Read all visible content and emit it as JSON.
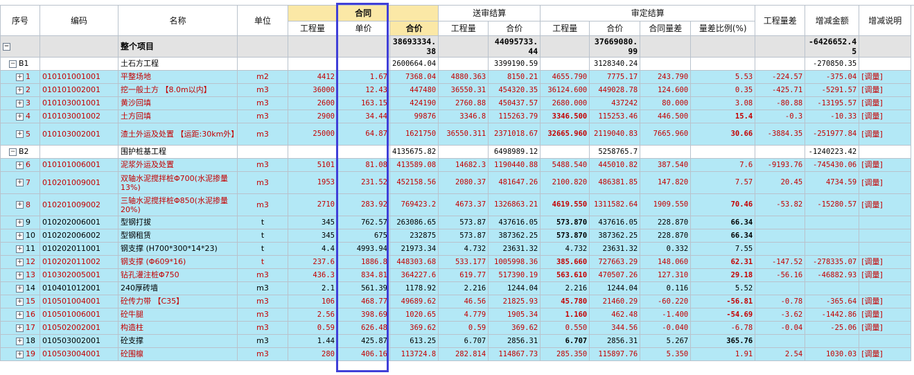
{
  "header": {
    "seq": "序号",
    "code": "编码",
    "name": "名称",
    "unit": "单位",
    "contract": "合同",
    "contract_qty": "工程量",
    "contract_price": "单价",
    "contract_total": "合价",
    "submitted": "送审结算",
    "sub_qty": "工程量",
    "sub_total": "合价",
    "approved": "审定结算",
    "app_qty": "工程量",
    "app_total": "合价",
    "app_diff": "合同量差",
    "app_ratio": "量差比例(%)",
    "qty_diff": "工程量差",
    "amount_change": "增减金额",
    "change_desc": "增减说明"
  },
  "rows": [
    {
      "type": "total",
      "seq": "",
      "code": "",
      "name": "整个项目",
      "unit": "",
      "cqty": "",
      "cprice": "",
      "ctotal": "38693334.38",
      "sqty": "",
      "stotal": "44095733.44",
      "aqty": "",
      "atotal": "37669080.99",
      "adiff": "",
      "aratio": "",
      "qdiff": "",
      "amount": "-6426652.45",
      "desc": ""
    },
    {
      "type": "grp",
      "seq": "B1",
      "code": "",
      "name": "土石方工程",
      "unit": "",
      "cqty": "",
      "cprice": "",
      "ctotal": "2600664.04",
      "sqty": "",
      "stotal": "3399190.59",
      "aqty": "",
      "atotal": "3128340.24",
      "adiff": "",
      "aratio": "",
      "qdiff": "",
      "amount": "-270850.35",
      "desc": ""
    },
    {
      "type": "item",
      "red": true,
      "seq": "1",
      "code": "010101001001",
      "name": "平整场地",
      "unit": "m2",
      "cqty": "4412",
      "cprice": "1.67",
      "ctotal": "7368.04",
      "sqty": "4880.363",
      "stotal": "8150.21",
      "aqty": "4655.790",
      "atotal": "7775.17",
      "adiff": "243.790",
      "aratio": "5.53",
      "qdiff": "-224.57",
      "amount": "-375.04",
      "desc": "[调量]"
    },
    {
      "type": "item",
      "red": true,
      "seq": "2",
      "code": "010101002001",
      "name": "挖一般土方 【8.0m以内】",
      "unit": "m3",
      "cqty": "36000",
      "cprice": "12.43",
      "ctotal": "447480",
      "sqty": "36550.31",
      "stotal": "454320.35",
      "aqty": "36124.600",
      "atotal": "449028.78",
      "adiff": "124.600",
      "aratio": "0.35",
      "qdiff": "-425.71",
      "amount": "-5291.57",
      "desc": "[调量]"
    },
    {
      "type": "item",
      "red": true,
      "seq": "3",
      "code": "010103001001",
      "name": "黄沙回填",
      "unit": "m3",
      "cqty": "2600",
      "cprice": "163.15",
      "ctotal": "424190",
      "sqty": "2760.88",
      "stotal": "450437.57",
      "aqty": "2680.000",
      "atotal": "437242",
      "adiff": "80.000",
      "aratio": "3.08",
      "qdiff": "-80.88",
      "amount": "-13195.57",
      "desc": "[调量]"
    },
    {
      "type": "item",
      "red": true,
      "seq": "4",
      "code": "010103001002",
      "name": "土方回填",
      "unit": "m3",
      "cqty": "2900",
      "cprice": "34.44",
      "ctotal": "99876",
      "sqty": "3346.8",
      "stotal": "115263.79",
      "aqty": "3346.500",
      "aqtyb": true,
      "atotal": "115253.46",
      "adiff": "446.500",
      "aratio": "15.4",
      "aratiob": true,
      "qdiff": "-0.3",
      "amount": "-10.33",
      "desc": "[调量]"
    },
    {
      "type": "item",
      "red": true,
      "tall": true,
      "seq": "5",
      "code": "010103002001",
      "name": "渣土外运及处置 【运距:30km外】",
      "unit": "m3",
      "cqty": "25000",
      "cprice": "64.87",
      "ctotal": "1621750",
      "sqty": "36550.311",
      "stotal": "2371018.67",
      "aqty": "32665.960",
      "aqtyb": true,
      "atotal": "2119040.83",
      "adiff": "7665.960",
      "aratio": "30.66",
      "aratiob": true,
      "qdiff": "-3884.35",
      "amount": "-251977.84",
      "desc": "[调量]"
    },
    {
      "type": "grp",
      "seq": "B2",
      "code": "",
      "name": "围护桩基工程",
      "unit": "",
      "cqty": "",
      "cprice": "",
      "ctotal": "4135675.82",
      "sqty": "",
      "stotal": "6498989.12",
      "aqty": "",
      "atotal": "5258765.7",
      "adiff": "",
      "aratio": "",
      "qdiff": "",
      "amount": "-1240223.42",
      "desc": ""
    },
    {
      "type": "item",
      "red": true,
      "seq": "6",
      "code": "010101006001",
      "name": "泥浆外运及处置",
      "unit": "m3",
      "cqty": "5101",
      "cprice": "81.08",
      "ctotal": "413589.08",
      "sqty": "14682.3",
      "stotal": "1190440.88",
      "aqty": "5488.540",
      "atotal": "445010.82",
      "adiff": "387.540",
      "aratio": "7.6",
      "qdiff": "-9193.76",
      "amount": "-745430.06",
      "desc": "[调量]"
    },
    {
      "type": "item",
      "red": true,
      "tall": true,
      "seq": "7",
      "code": "010201009001",
      "name": "双轴水泥搅拌桩Φ700(水泥掺量13%)",
      "unit": "m3",
      "cqty": "1953",
      "cprice": "231.52",
      "ctotal": "452158.56",
      "sqty": "2080.37",
      "stotal": "481647.26",
      "aqty": "2100.820",
      "atotal": "486381.85",
      "adiff": "147.820",
      "aratio": "7.57",
      "qdiff": "20.45",
      "amount": "4734.59",
      "desc": "[调量]"
    },
    {
      "type": "item",
      "red": true,
      "tall": true,
      "seq": "8",
      "code": "010201009002",
      "name": "三轴水泥搅拌桩Φ850(水泥掺量20%)",
      "unit": "m3",
      "cqty": "2710",
      "cprice": "283.92",
      "ctotal": "769423.2",
      "sqty": "4673.37",
      "stotal": "1326863.21",
      "aqty": "4619.550",
      "aqtyb": true,
      "atotal": "1311582.64",
      "adiff": "1909.550",
      "aratio": "70.46",
      "aratiob": true,
      "qdiff": "-53.82",
      "amount": "-15280.57",
      "desc": "[调量]"
    },
    {
      "type": "item",
      "red": false,
      "seq": "9",
      "code": "010202006001",
      "name": "型钢打拔",
      "unit": "t",
      "cqty": "345",
      "cprice": "762.57",
      "ctotal": "263086.65",
      "sqty": "573.87",
      "stotal": "437616.05",
      "aqty": "573.870",
      "aqtyb": true,
      "atotal": "437616.05",
      "adiff": "228.870",
      "aratio": "66.34",
      "aratiob": true,
      "qdiff": "",
      "amount": "",
      "desc": ""
    },
    {
      "type": "item",
      "red": false,
      "seq": "10",
      "code": "010202006002",
      "name": "型钢租赁",
      "unit": "t",
      "cqty": "345",
      "cprice": "675",
      "ctotal": "232875",
      "sqty": "573.87",
      "stotal": "387362.25",
      "aqty": "573.870",
      "aqtyb": true,
      "atotal": "387362.25",
      "adiff": "228.870",
      "aratio": "66.34",
      "aratiob": true,
      "qdiff": "",
      "amount": "",
      "desc": ""
    },
    {
      "type": "item",
      "red": false,
      "seq": "11",
      "code": "010202011001",
      "name": "钢支撑 (H700*300*14*23)",
      "unit": "t",
      "cqty": "4.4",
      "cprice": "4993.94",
      "ctotal": "21973.34",
      "sqty": "4.732",
      "stotal": "23631.32",
      "aqty": "4.732",
      "atotal": "23631.32",
      "adiff": "0.332",
      "aratio": "7.55",
      "qdiff": "",
      "amount": "",
      "desc": ""
    },
    {
      "type": "item",
      "red": true,
      "seq": "12",
      "code": "010202011002",
      "name": "钢支撑 (Φ609*16)",
      "unit": "t",
      "cqty": "237.6",
      "cprice": "1886.8",
      "ctotal": "448303.68",
      "sqty": "533.177",
      "stotal": "1005998.36",
      "aqty": "385.660",
      "aqtyb": true,
      "atotal": "727663.29",
      "adiff": "148.060",
      "aratio": "62.31",
      "aratiob": true,
      "qdiff": "-147.52",
      "amount": "-278335.07",
      "desc": "[调量]"
    },
    {
      "type": "item",
      "red": true,
      "seq": "13",
      "code": "010302005001",
      "name": "钻孔灌注桩Φ750",
      "unit": "m3",
      "cqty": "436.3",
      "cprice": "834.81",
      "ctotal": "364227.6",
      "sqty": "619.77",
      "stotal": "517390.19",
      "aqty": "563.610",
      "aqtyb": true,
      "atotal": "470507.26",
      "adiff": "127.310",
      "aratio": "29.18",
      "aratiob": true,
      "qdiff": "-56.16",
      "amount": "-46882.93",
      "desc": "[调量]"
    },
    {
      "type": "item",
      "red": false,
      "seq": "14",
      "code": "010401012001",
      "name": "240厚砖墙",
      "unit": "m3",
      "cqty": "2.1",
      "cprice": "561.39",
      "ctotal": "1178.92",
      "sqty": "2.216",
      "stotal": "1244.04",
      "aqty": "2.216",
      "atotal": "1244.04",
      "adiff": "0.116",
      "aratio": "5.52",
      "qdiff": "",
      "amount": "",
      "desc": ""
    },
    {
      "type": "item",
      "red": true,
      "seq": "15",
      "code": "010501004001",
      "name": "砼传力带 【C35】",
      "unit": "m3",
      "cqty": "106",
      "cprice": "468.77",
      "ctotal": "49689.62",
      "sqty": "46.56",
      "stotal": "21825.93",
      "aqty": "45.780",
      "aqtyb": true,
      "atotal": "21460.29",
      "adiff": "-60.220",
      "aratio": "-56.81",
      "aratiob": true,
      "qdiff": "-0.78",
      "amount": "-365.64",
      "desc": "[调量]"
    },
    {
      "type": "item",
      "red": true,
      "seq": "16",
      "code": "010501006001",
      "name": "砼牛腿",
      "unit": "m3",
      "cqty": "2.56",
      "cprice": "398.69",
      "ctotal": "1020.65",
      "sqty": "4.779",
      "stotal": "1905.34",
      "aqty": "1.160",
      "aqtyb": true,
      "atotal": "462.48",
      "adiff": "-1.400",
      "aratio": "-54.69",
      "aratiob": true,
      "qdiff": "-3.62",
      "amount": "-1442.86",
      "desc": "[调量]"
    },
    {
      "type": "item",
      "red": true,
      "seq": "17",
      "code": "010502002001",
      "name": "构造柱",
      "unit": "m3",
      "cqty": "0.59",
      "cprice": "626.48",
      "ctotal": "369.62",
      "sqty": "0.59",
      "stotal": "369.62",
      "aqty": "0.550",
      "atotal": "344.56",
      "adiff": "-0.040",
      "aratio": "-6.78",
      "qdiff": "-0.04",
      "amount": "-25.06",
      "desc": "[调量]"
    },
    {
      "type": "item",
      "red": false,
      "seq": "18",
      "code": "010503002001",
      "name": "砼支撑",
      "unit": "m3",
      "cqty": "1.44",
      "cprice": "425.87",
      "ctotal": "613.25",
      "sqty": "6.707",
      "stotal": "2856.31",
      "aqty": "6.707",
      "aqtyb": true,
      "atotal": "2856.31",
      "adiff": "5.267",
      "aratio": "365.76",
      "aratiob": true,
      "qdiff": "",
      "amount": "",
      "desc": ""
    },
    {
      "type": "item",
      "red": true,
      "seq": "19",
      "code": "010503004001",
      "name": "砼围檩",
      "unit": "m3",
      "cqty": "280",
      "cprice": "406.16",
      "ctotal": "113724.8",
      "sqty": "282.814",
      "stotal": "114867.73",
      "aqty": "285.350",
      "atotal": "115897.76",
      "adiff": "5.350",
      "aratio": "1.91",
      "qdiff": "2.54",
      "amount": "1030.03",
      "desc": "[调量]"
    }
  ]
}
